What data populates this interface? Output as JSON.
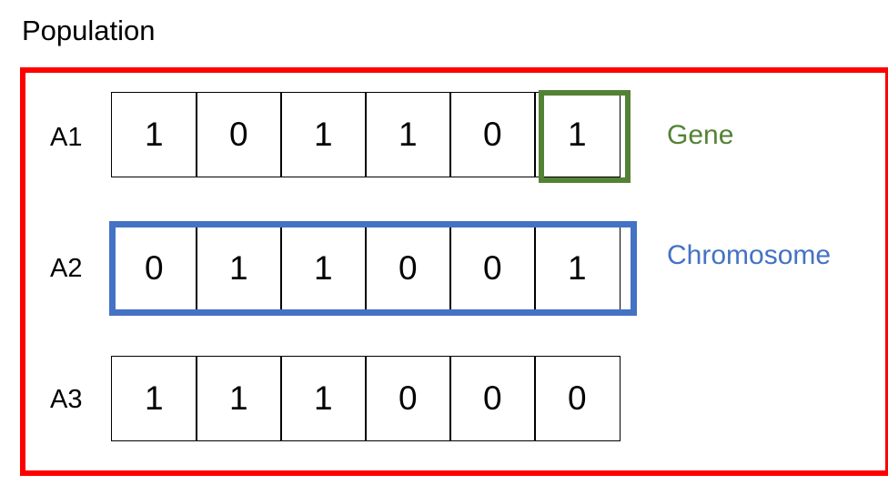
{
  "title": "Population",
  "colors": {
    "population_border": "#ff0000",
    "gene": "#548235",
    "chromosome": "#4472c4"
  },
  "rows": [
    {
      "label": "A1",
      "genes": [
        "1",
        "0",
        "1",
        "1",
        "0",
        "1"
      ]
    },
    {
      "label": "A2",
      "genes": [
        "0",
        "1",
        "1",
        "0",
        "0",
        "1"
      ]
    },
    {
      "label": "A3",
      "genes": [
        "1",
        "1",
        "1",
        "0",
        "0",
        "0"
      ]
    }
  ],
  "annotations": {
    "gene": "Gene",
    "chromosome": "Chromosome"
  }
}
